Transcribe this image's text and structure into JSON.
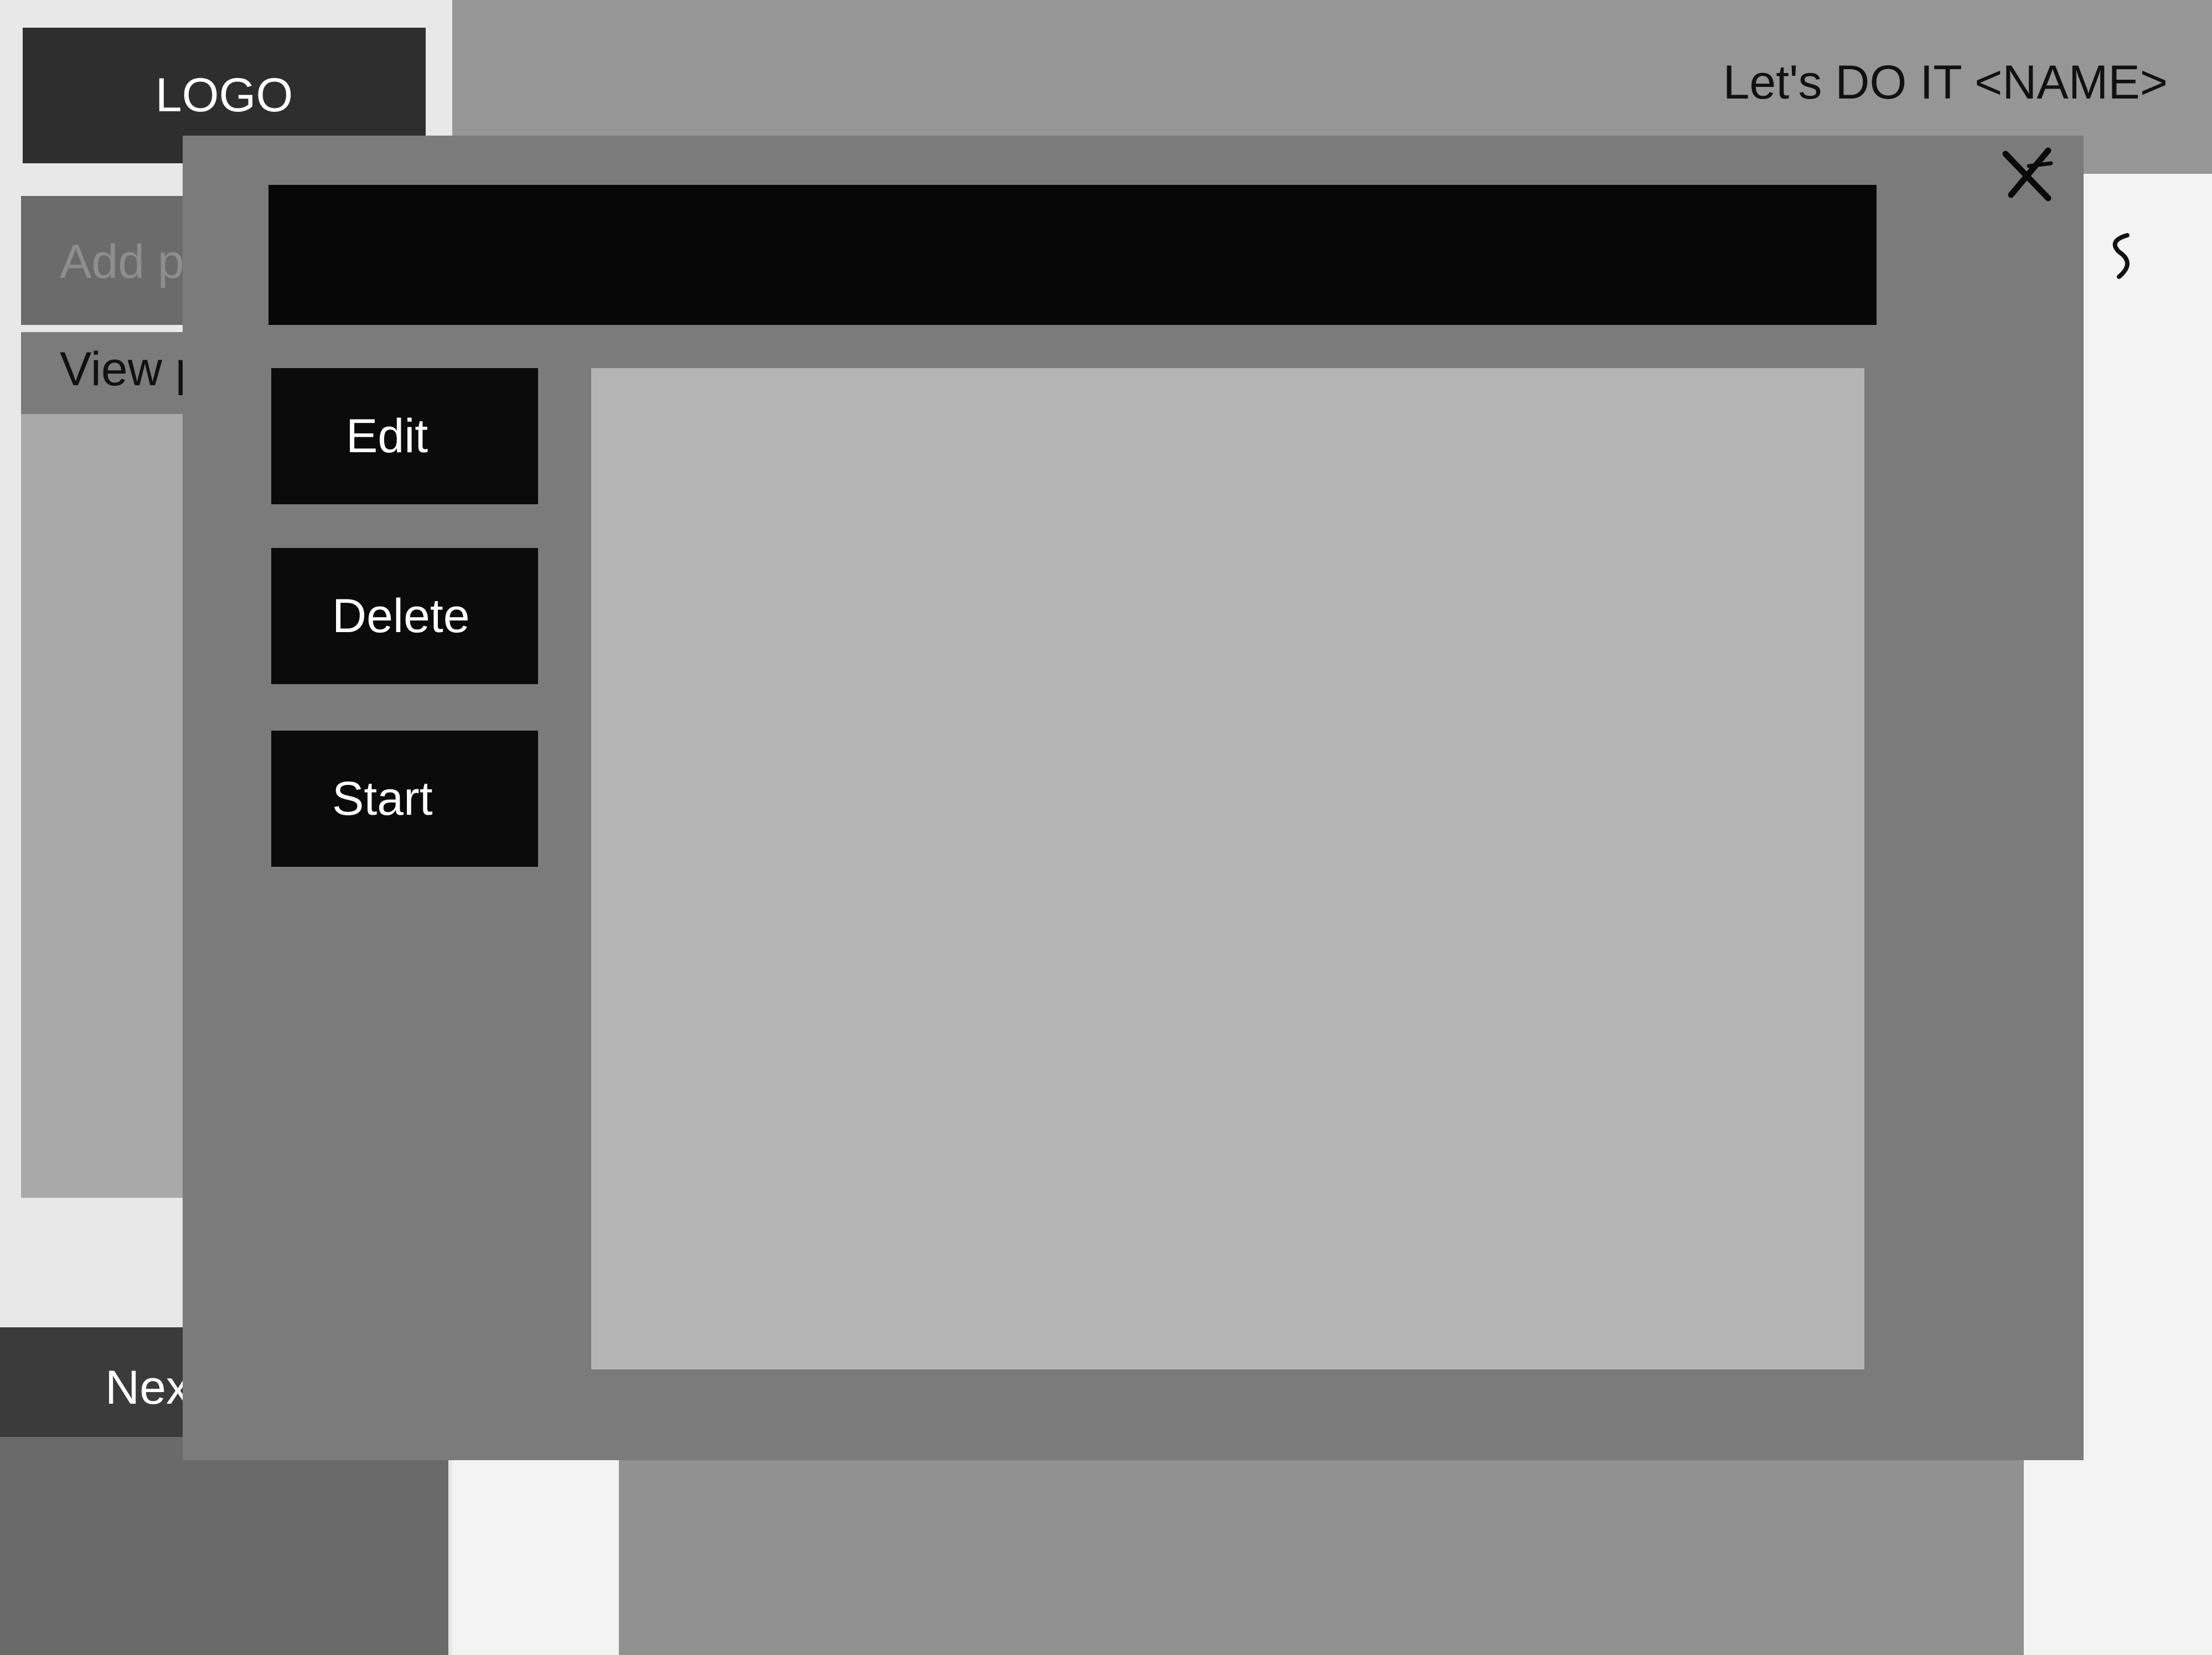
{
  "header": {
    "logo": "LOGO",
    "greeting": "Let's DO IT <NAME>"
  },
  "sidebar": {
    "add_item": "Add p",
    "view_item": "View p",
    "next_button": "Nex"
  },
  "modal": {
    "title": "",
    "buttons": {
      "edit": "Edit",
      "delete": "Delete",
      "start": "Start"
    },
    "close_icon": "close-icon"
  },
  "colors": {
    "background": "#f3f3f3",
    "modal": "#7b7b7b",
    "button": "#0b0b0b",
    "content_area": "#b5b5b5"
  }
}
